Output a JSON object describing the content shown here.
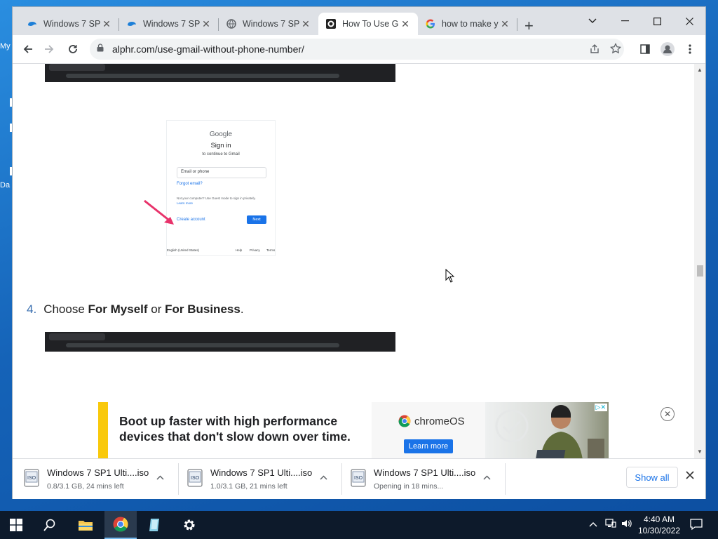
{
  "desktop": {
    "label_top": "My",
    "label_bottom": "Da"
  },
  "browser": {
    "tabs": [
      {
        "title": "Windows 7 SP",
        "icon": "blue-cloud-icon",
        "active": false
      },
      {
        "title": "Windows 7 SP",
        "icon": "blue-cloud-icon",
        "active": false
      },
      {
        "title": "Windows 7 SP",
        "icon": "globe-icon",
        "active": false
      },
      {
        "title": "How To Use G",
        "icon": "alphr-icon",
        "active": true
      },
      {
        "title": "how to make y",
        "icon": "google-icon",
        "active": false
      }
    ],
    "url": "alphr.com/use-gmail-without-phone-number/"
  },
  "page": {
    "signin_card": {
      "brand": "Google",
      "heading": "Sign in",
      "subheading": "to continue to Gmail",
      "field_placeholder": "Email or phone",
      "forgot": "Forgot email?",
      "notice": "Not your computer? Use Guest mode to sign in privately.",
      "learn_more": "Learn more",
      "create_account": "Create account",
      "next": "Next",
      "language": "English (United States)",
      "help": "Help",
      "privacy": "Privacy",
      "terms": "Terms"
    },
    "step": {
      "number": "4.",
      "pre": "Choose ",
      "option1": "For Myself",
      "mid": " or ",
      "option2": "For Business",
      "post": "."
    },
    "ad": {
      "headline": "Boot up faster with high performance devices that don't slow down over time.",
      "brand": "chromeOS",
      "cta": "Learn more"
    }
  },
  "downloads": {
    "items": [
      {
        "name": "Windows 7 SP1 Ulti....iso",
        "status": "0.8/3.1 GB, 24 mins left"
      },
      {
        "name": "Windows 7 SP1 Ulti....iso",
        "status": "1.0/3.1 GB, 21 mins left"
      },
      {
        "name": "Windows 7 SP1 Ulti....iso",
        "status": "Opening in 18 mins..."
      }
    ],
    "show_all": "Show all"
  },
  "taskbar": {
    "time": "4:40 AM",
    "date": "10/30/2022"
  }
}
